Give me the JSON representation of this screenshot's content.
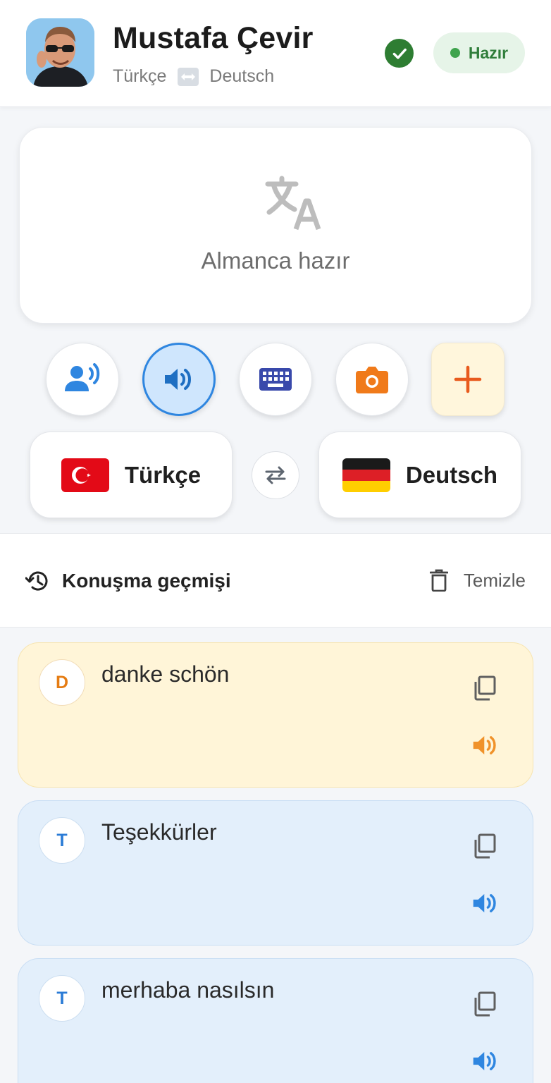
{
  "header": {
    "user_name": "Mustafa Çevir",
    "source_lang": "Türkçe",
    "target_lang": "Deutsch",
    "status": "Hazır"
  },
  "display": {
    "text": "Almanca hazır"
  },
  "actions": [
    {
      "name": "voice-input",
      "icon": "speaking-person-icon",
      "active": false
    },
    {
      "name": "speaker",
      "icon": "volume-icon",
      "active": true
    },
    {
      "name": "keyboard",
      "icon": "keyboard-icon",
      "active": false
    },
    {
      "name": "camera",
      "icon": "camera-icon",
      "active": false
    },
    {
      "name": "add",
      "icon": "plus-icon",
      "active": false
    }
  ],
  "languages": {
    "left": {
      "label": "Türkçe",
      "flag": "turkey-flag"
    },
    "right": {
      "label": "Deutsch",
      "flag": "germany-flag"
    }
  },
  "history": {
    "title": "Konuşma geçmişi",
    "clear_label": "Temizle",
    "messages": [
      {
        "badge": "D",
        "text": "danke schön",
        "lang": "de"
      },
      {
        "badge": "T",
        "text": "Teşekkürler",
        "lang": "tr"
      },
      {
        "badge": "T",
        "text": "merhaba nasılsın",
        "lang": "tr"
      }
    ]
  },
  "colors": {
    "accent_blue": "#2f86e0",
    "success_green": "#2e7d32",
    "orange": "#f07a1a",
    "keyboard_indigo": "#3949ab",
    "german_card": "#fff5d8",
    "turkish_card": "#e3effb"
  }
}
